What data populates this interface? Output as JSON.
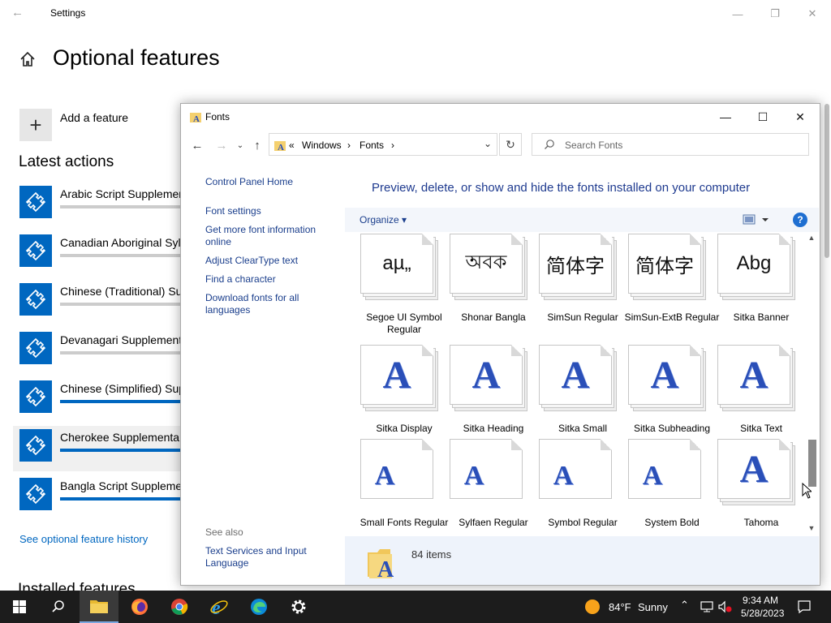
{
  "settings": {
    "title": "Settings",
    "page_title": "Optional features",
    "add_feature": "Add a feature",
    "latest_heading": "Latest actions",
    "features": [
      {
        "name": "Arabic Script Supplemen",
        "bar": "gray"
      },
      {
        "name": "Canadian Aboriginal Syll",
        "bar": "gray"
      },
      {
        "name": "Chinese (Traditional) Sup",
        "bar": "gray"
      },
      {
        "name": "Devanagari Supplement",
        "bar": "gray"
      },
      {
        "name": "Chinese (Simplified) Sup",
        "bar": "blue"
      },
      {
        "name": "Cherokee Supplemental",
        "bar": "blue"
      },
      {
        "name": "Bangla Script Supplemen",
        "bar": "blue"
      }
    ],
    "history_link": "See optional feature history",
    "installed_heading": "Installed features",
    "accent_color": "#0067c0"
  },
  "fonts_window": {
    "title": "Fonts",
    "address": {
      "overflow": "«",
      "seg1": "Windows",
      "seg2": "Fonts"
    },
    "search_placeholder": "Search Fonts",
    "left_pane": {
      "links": [
        "Control Panel Home",
        "Font settings",
        "Get more font information online",
        "Adjust ClearType text",
        "Find a character",
        "Download fonts for all languages"
      ],
      "see_also": "See also",
      "see_also_link": "Text Services and Input Language"
    },
    "heading": "Preview, delete, or show and hide the fonts installed on your computer",
    "organize": "Organize",
    "fonts": [
      {
        "label": "Segoe UI Symbol Regular",
        "preview": "aµ„"
      },
      {
        "label": "Shonar Bangla",
        "preview": "অবক"
      },
      {
        "label": "SimSun Regular",
        "preview": "简体字"
      },
      {
        "label": "SimSun-ExtB Regular",
        "preview": "简体字"
      },
      {
        "label": "Sitka Banner",
        "preview": "Abg"
      },
      {
        "label": "Sitka Display",
        "preview": "A"
      },
      {
        "label": "Sitka Heading",
        "preview": "A"
      },
      {
        "label": "Sitka Small",
        "preview": "A"
      },
      {
        "label": "Sitka Subheading",
        "preview": "A"
      },
      {
        "label": "Sitka Text",
        "preview": "A"
      },
      {
        "label": "Small Fonts Regular",
        "preview": "A"
      },
      {
        "label": "Sylfaen Regular",
        "preview": "A"
      },
      {
        "label": "Symbol Regular",
        "preview": "A"
      },
      {
        "label": "System Bold",
        "preview": "A"
      },
      {
        "label": "Tahoma",
        "preview": "A"
      }
    ],
    "status": "84 items"
  },
  "taskbar": {
    "weather_temp": "84°F",
    "weather_desc": "Sunny",
    "time": "9:34 AM",
    "date": "5/28/2023"
  }
}
